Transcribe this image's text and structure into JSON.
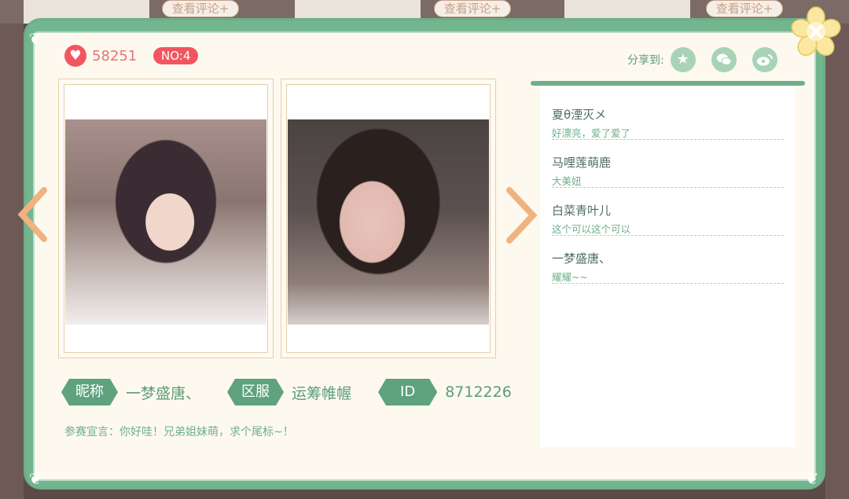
{
  "background": {
    "button_label": "查看评论+"
  },
  "header": {
    "likes": "58251",
    "rank": "NO:4",
    "share_label": "分享到:"
  },
  "icons": {
    "heart": "heart-icon",
    "share": [
      "qzone-icon",
      "wechat-icon",
      "weibo-icon"
    ],
    "close": "close-icon",
    "prev": "chevron-left-icon",
    "next": "chevron-right-icon"
  },
  "profile": {
    "nickname_label": "昵称",
    "nickname": "一梦盛唐、",
    "server_label": "区服",
    "server": "运筹帷幄",
    "id_label": "ID",
    "id": "8712226",
    "declaration": "参赛宣言：你好哇！兄弟姐妹萌，求个尾标~！"
  },
  "comments": [
    {
      "name": "夏θ湮灭メ",
      "text": "好漂亮，爱了爱了"
    },
    {
      "name": "马哩莲萌鹿",
      "text": "大美妞"
    },
    {
      "name": "白菜青叶儿",
      "text": "这个可以这个可以"
    },
    {
      "name": "一梦盛唐、",
      "text": "耀耀~~"
    }
  ],
  "colors": {
    "accent_green": "#6daf8a",
    "badge_red": "#f2555f",
    "arrow_orange": "#f0b27f"
  }
}
